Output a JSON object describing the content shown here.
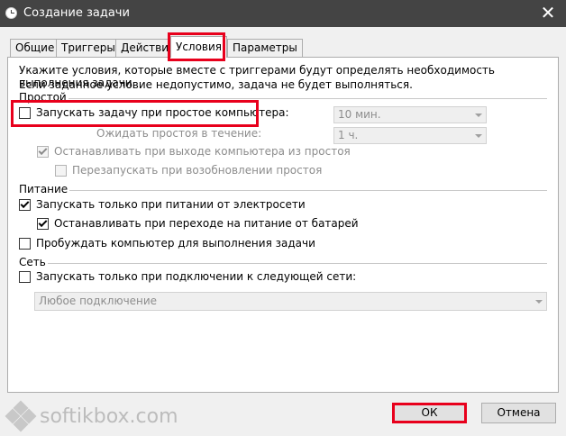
{
  "window": {
    "title": "Создание задачи",
    "close_glyph": "✕"
  },
  "tabs": [
    {
      "label": "Общие"
    },
    {
      "label": "Триггеры"
    },
    {
      "label": "Действия"
    },
    {
      "label": "Условия"
    },
    {
      "label": "Параметры"
    }
  ],
  "active_tab": "Условия",
  "description": {
    "line1": "Укажите условия, которые вместе с триггерами будут определять необходимость выполнения задачи.",
    "line2": "Если заданное условие недопустимо, задача не будет выполняться."
  },
  "idle": {
    "section": "Простой",
    "start_if_idle": {
      "label": "Запускать задачу при простое компьютера:",
      "checked": false
    },
    "idle_duration": {
      "value": "10 мин."
    },
    "wait_label": "Ожидать простоя в течение:",
    "wait_duration": {
      "value": "1 ч."
    },
    "stop_on_idle_end": {
      "label": "Останавливать при выходе компьютера из простоя",
      "checked": true
    },
    "restart_on_idle": {
      "label": "Перезапускать при возобновлении простоя",
      "checked": false
    }
  },
  "power": {
    "section": "Питание",
    "ac_only": {
      "label": "Запускать только при питании от электросети",
      "checked": true
    },
    "stop_on_battery": {
      "label": "Останавливать при переходе на питание от батарей",
      "checked": true
    },
    "wake": {
      "label": "Пробуждать компьютер для выполнения задачи",
      "checked": false
    }
  },
  "network": {
    "section": "Сеть",
    "only_network": {
      "label": "Запускать только при подключении к следующей сети:",
      "checked": false
    },
    "network_combo": {
      "value": "Любое подключение"
    }
  },
  "buttons": {
    "ok": "ОК",
    "cancel": "Отмена"
  },
  "watermark": {
    "text": "softikbox.com"
  },
  "colors": {
    "highlight": "#e8001c",
    "titlebar": "#444444",
    "accent": "#0078d7"
  }
}
